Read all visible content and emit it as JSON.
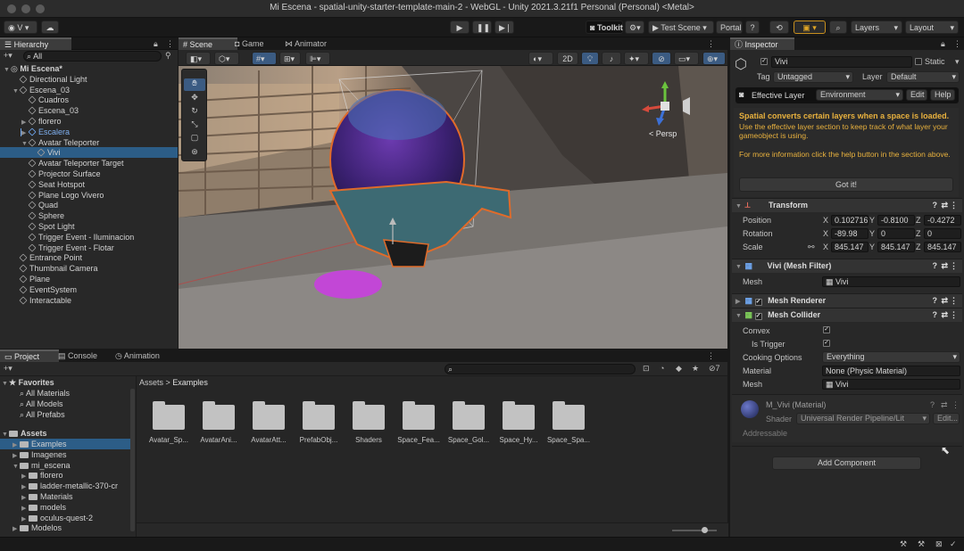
{
  "window": {
    "title": "Mi Escena - spatial-unity-starter-template-main-2 - WebGL - Unity 2021.3.21f1 Personal (Personal) <Metal>"
  },
  "toolbar": {
    "account": "V",
    "toolkit": "Toolkit",
    "test_scene": "Test Scene",
    "portal": "Portal",
    "layers": "Layers",
    "layout": "Layout"
  },
  "hierarchy": {
    "tab": "Hierarchy",
    "search_placeholder": "All",
    "items": [
      {
        "label": "Mi Escena*",
        "indent": 0,
        "type": "scene",
        "expanded": true
      },
      {
        "label": "Directional Light",
        "indent": 1
      },
      {
        "label": "Escena_03",
        "indent": 1,
        "expanded": true
      },
      {
        "label": "Cuadros",
        "indent": 2
      },
      {
        "label": "Escena_03",
        "indent": 2
      },
      {
        "label": "florero",
        "indent": 2,
        "collapsed": true
      },
      {
        "label": "Escalera",
        "indent": 2,
        "collapsed": true,
        "prefab": true
      },
      {
        "label": "Avatar Teleporter",
        "indent": 2,
        "expanded": true
      },
      {
        "label": "Vivi",
        "indent": 3,
        "selected": true
      },
      {
        "label": "Avatar Teleporter Target",
        "indent": 2
      },
      {
        "label": "Projector Surface",
        "indent": 2
      },
      {
        "label": "Seat Hotspot",
        "indent": 2
      },
      {
        "label": "Plane Logo Vivero",
        "indent": 2
      },
      {
        "label": "Quad",
        "indent": 2
      },
      {
        "label": "Sphere",
        "indent": 2
      },
      {
        "label": "Spot Light",
        "indent": 2
      },
      {
        "label": "Trigger Event - Iluminacion",
        "indent": 2
      },
      {
        "label": "Trigger Event - Flotar",
        "indent": 2
      },
      {
        "label": "Entrance Point",
        "indent": 1
      },
      {
        "label": "Thumbnail Camera",
        "indent": 1
      },
      {
        "label": "Plane",
        "indent": 1
      },
      {
        "label": "EventSystem",
        "indent": 1
      },
      {
        "label": "Interactable",
        "indent": 1
      }
    ]
  },
  "scene_tabs": {
    "scene": "Scene",
    "game": "Game",
    "animator": "Animator",
    "mode_2d": "2D",
    "persp": "< Persp"
  },
  "bottom_tabs": {
    "project": "Project",
    "console": "Console",
    "animation": "Animation"
  },
  "project": {
    "favorites_label": "Favorites",
    "favorites": [
      "All Materials",
      "All Models",
      "All Prefabs"
    ],
    "assets_label": "Assets",
    "tree": [
      {
        "label": "Examples",
        "indent": 1,
        "selected": true
      },
      {
        "label": "Imagenes",
        "indent": 1
      },
      {
        "label": "mi_escena",
        "indent": 1,
        "expanded": true
      },
      {
        "label": "florero",
        "indent": 2
      },
      {
        "label": "ladder-metallic-370-cr",
        "indent": 2
      },
      {
        "label": "Materials",
        "indent": 2
      },
      {
        "label": "models",
        "indent": 2
      },
      {
        "label": "oculus-quest-2",
        "indent": 2
      },
      {
        "label": "Modelos",
        "indent": 1
      }
    ],
    "breadcrumb_root": "Assets",
    "breadcrumb_current": "Examples",
    "badge_count": "7",
    "folders": [
      "Avatar_Sp...",
      "AvatarAni...",
      "AvatarAtt...",
      "PrefabObj...",
      "Shaders",
      "Space_Fea...",
      "Space_Gol...",
      "Space_Hy...",
      "Space_Spa..."
    ]
  },
  "inspector": {
    "tab": "Inspector",
    "object_name": "Vivi",
    "static_label": "Static",
    "tag_label": "Tag",
    "tag_value": "Untagged",
    "layer_label": "Layer",
    "layer_value": "Default",
    "effective_layer_label": "Effective Layer",
    "effective_layer_value": "Environment",
    "edit_btn": "Edit",
    "help_btn": "Help",
    "notice_title": "Spatial converts certain layers when a space is loaded.",
    "notice_body": "Use the effective layer section to keep track of what layer your gameobject is using.",
    "notice_more": "For more information click the help button in the section above.",
    "got_it": "Got it!",
    "transform": {
      "title": "Transform",
      "position_label": "Position",
      "position": [
        "0.102716",
        "-0.8100",
        "-0.4272"
      ],
      "rotation_label": "Rotation",
      "rotation": [
        "-89.98",
        "0",
        "0"
      ],
      "scale_label": "Scale",
      "scale": [
        "845.147",
        "845.147",
        "845.147"
      ],
      "axis_x": "X",
      "axis_y": "Y",
      "axis_z": "Z"
    },
    "mesh_filter": {
      "title": "Vivi (Mesh Filter)",
      "mesh_label": "Mesh",
      "mesh_value": "Vivi"
    },
    "mesh_renderer": {
      "title": "Mesh Renderer"
    },
    "mesh_collider": {
      "title": "Mesh Collider",
      "convex_label": "Convex",
      "is_trigger_label": "Is Trigger",
      "cooking_label": "Cooking Options",
      "cooking_value": "Everything",
      "material_label": "Material",
      "material_value": "None (Physic Material)",
      "mesh_label": "Mesh",
      "mesh_value": "Vivi"
    },
    "material": {
      "title": "M_Vivi (Material)",
      "shader_label": "Shader",
      "shader_value": "Universal Render Pipeline/Lit",
      "edit_btn": "Edit...",
      "addressable": "Addressable"
    },
    "add_component": "Add Component"
  }
}
